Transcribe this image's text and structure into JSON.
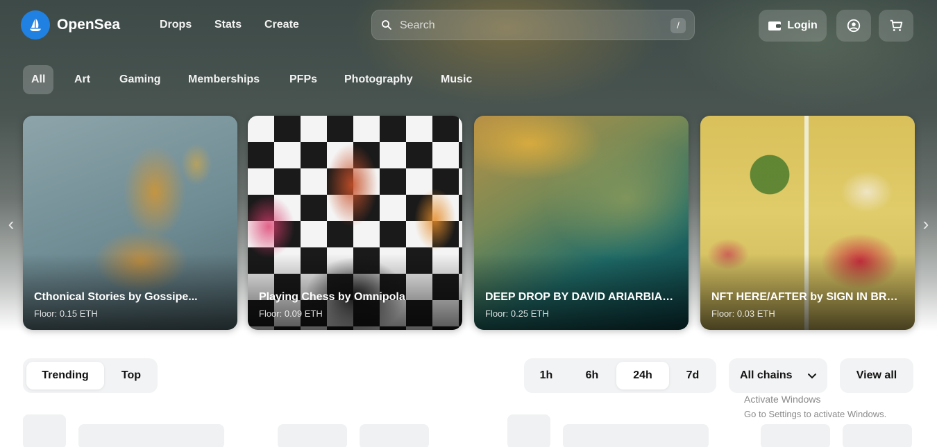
{
  "brand": {
    "name": "OpenSea"
  },
  "nav": {
    "links": [
      "Drops",
      "Stats",
      "Create"
    ]
  },
  "search": {
    "placeholder": "Search",
    "shortcut": "/"
  },
  "account": {
    "login_label": "Login"
  },
  "categories": [
    "All",
    "Art",
    "Gaming",
    "Memberships",
    "PFPs",
    "Photography",
    "Music"
  ],
  "featured": [
    {
      "title": "Cthonical Stories by Gossipe...",
      "floor": "Floor: 0.15 ETH",
      "verified": false
    },
    {
      "title": "Playing Chess by Omnipola",
      "floor": "Floor: 0.09 ETH",
      "verified": false
    },
    {
      "title": "DEEP DROP BY DAVID ARIARBIAN",
      "floor": "Floor: 0.25 ETH",
      "verified": true
    },
    {
      "title": "NFT HERE/AFTER by SIGN IN BRAIN",
      "floor": "Floor: 0.03 ETH",
      "verified": true
    }
  ],
  "rankings": {
    "tabs": [
      "Trending",
      "Top"
    ],
    "active_tab": "Trending",
    "time_ranges": [
      "1h",
      "6h",
      "24h",
      "7d"
    ],
    "active_range": "24h",
    "chains_label": "All chains",
    "view_all_label": "View all"
  },
  "system_notice": {
    "line1": "Activate Windows",
    "line2": "Go to Settings to activate Windows."
  },
  "colors": {
    "accent": "#2081e2",
    "segment_bg": "#f2f3f4"
  }
}
